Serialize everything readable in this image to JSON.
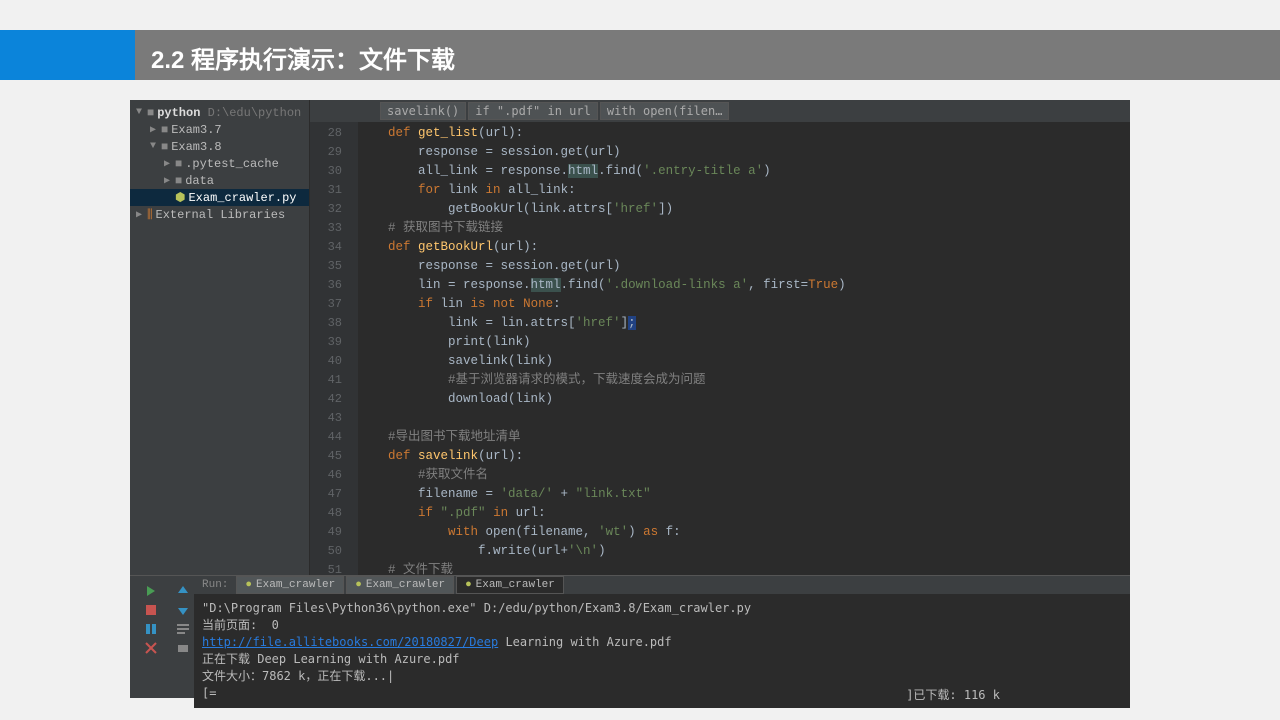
{
  "title": "2.2 程序执行演示：文件下载",
  "project": {
    "root": "python",
    "root_path": "D:\\edu\\python",
    "nodes": [
      {
        "label": "Exam3.7",
        "depth": 1,
        "expand": "▶",
        "icon": "folder"
      },
      {
        "label": "Exam3.8",
        "depth": 1,
        "expand": "▼",
        "icon": "folder"
      },
      {
        "label": ".pytest_cache",
        "depth": 2,
        "expand": "▶",
        "icon": "folder"
      },
      {
        "label": "data",
        "depth": 2,
        "expand": "▶",
        "icon": "folder"
      },
      {
        "label": "Exam_crawler.py",
        "depth": 2,
        "expand": "",
        "icon": "py",
        "selected": true
      }
    ],
    "external": "External Libraries"
  },
  "breadcrumb": [
    "savelink()",
    "if \".pdf\" in url",
    "with open(filen…"
  ],
  "code_lines": [
    {
      "n": 28,
      "html": "<span class='kw'>def</span> <span class='fn'>get_list</span>(url):"
    },
    {
      "n": 29,
      "html": "    response = session.get(url)"
    },
    {
      "n": 30,
      "html": "    all_link = response.<span class='hl'>html</span>.find(<span class='str'>'.entry-title a'</span>)"
    },
    {
      "n": 31,
      "html": "    <span class='kw'>for</span> link <span class='kw'>in</span> all_link:"
    },
    {
      "n": 32,
      "html": "        getBookUrl(link.attrs[<span class='str'>'href'</span>])"
    },
    {
      "n": 33,
      "html": "<span class='com'># 获取图书下载链接</span>"
    },
    {
      "n": 34,
      "html": "<span class='kw'>def</span> <span class='fn'>getBookUrl</span>(url):"
    },
    {
      "n": 35,
      "html": "    response = session.get(url)"
    },
    {
      "n": 36,
      "html": "    lin = response.<span class='hl'>html</span>.find(<span class='str'>'.download-links a'</span>, first=<span class='kw'>True</span>)"
    },
    {
      "n": 37,
      "html": "    <span class='kw'>if</span> lin <span class='kw'>is not</span> <span class='kw'>None</span>:"
    },
    {
      "n": 38,
      "html": "        link = lin.attrs[<span class='str'>'href'</span>]<span style='background:#214283'>;</span>"
    },
    {
      "n": 39,
      "html": "        print(link)"
    },
    {
      "n": 40,
      "html": "        savelink(link)"
    },
    {
      "n": 41,
      "html": "        <span class='com'>#基于浏览器请求的模式，下载速度会成为问题</span>"
    },
    {
      "n": 42,
      "html": "        download(link)"
    },
    {
      "n": 43,
      "html": ""
    },
    {
      "n": 44,
      "html": "<span class='com'>#导出图书下载地址清单</span>"
    },
    {
      "n": 45,
      "html": "<span class='kw'>def</span> <span class='fn'>savelink</span>(url):"
    },
    {
      "n": 46,
      "html": "    <span class='com'>#获取文件名</span>"
    },
    {
      "n": 47,
      "html": "    filename = <span class='str'>'data/'</span> + <span class='str'>\"link.txt\"</span>"
    },
    {
      "n": 48,
      "html": "    <span class='kw'>if</span> <span class='str'>\".pdf\"</span> <span class='kw'>in</span> url:"
    },
    {
      "n": 49,
      "html": "        <span class='kw'>with</span> open(filename, <span class='str'>'wt'</span>) <span class='kw'>as</span> f:"
    },
    {
      "n": 50,
      "html": "            f.write(url+<span class='str'>'\\n'</span>)"
    },
    {
      "n": 51,
      "html": "<span class='com'># 文件下载</span>"
    }
  ],
  "run": {
    "label": "Run:",
    "tabs": [
      "Exam_crawler",
      "Exam_crawler",
      "Exam_crawler"
    ],
    "cmd": "\"D:\\Program Files\\Python36\\python.exe\" D:/edu/python/Exam3.8/Exam_crawler.py",
    "line2": "当前页面:  0",
    "link": "http://file.allitebooks.com/20180827/Deep",
    "link_after": " Learning with Azure.pdf",
    "line4": "正在下载 Deep Learning with Azure.pdf",
    "line5": "文件大小：7862 k，正在下载...|",
    "line6": "[=",
    "progress": "]已下载: 116 k"
  }
}
